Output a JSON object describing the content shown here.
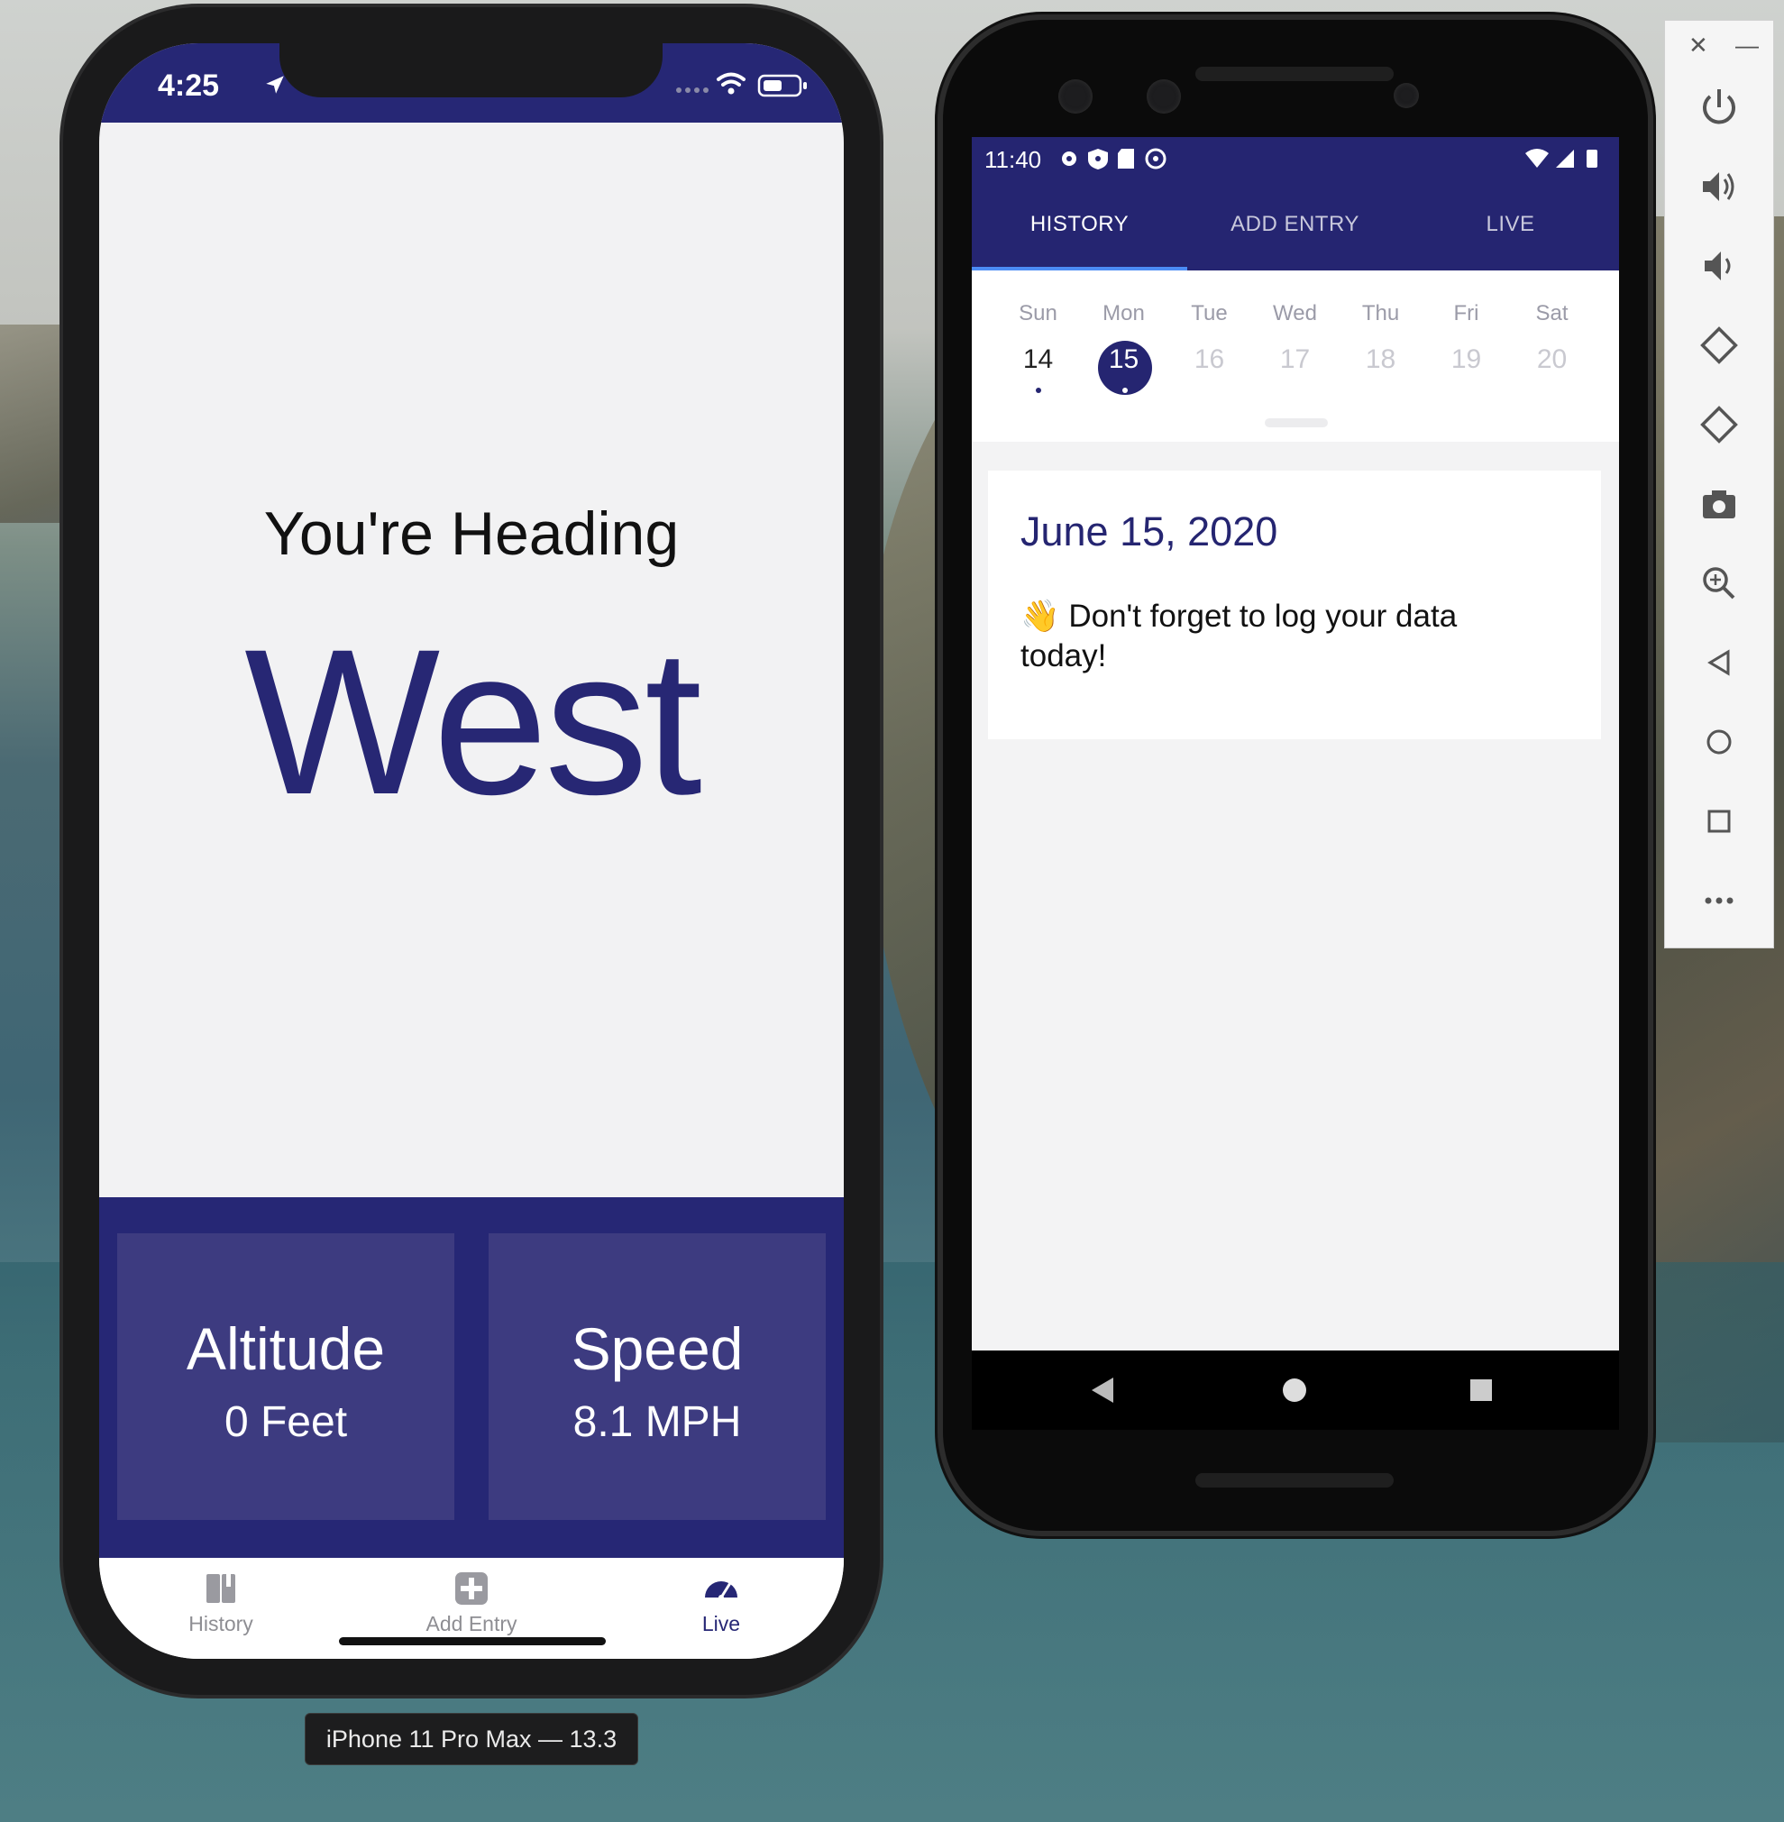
{
  "ios": {
    "status": {
      "time": "4:25"
    },
    "heading_label": "You're Heading",
    "heading_value": "West",
    "stats": [
      {
        "label": "Altitude",
        "value": "0 Feet"
      },
      {
        "label": "Speed",
        "value": "8.1 MPH"
      }
    ],
    "tabs": [
      {
        "label": "History",
        "icon": "book-icon"
      },
      {
        "label": "Add Entry",
        "icon": "plus-square-icon"
      },
      {
        "label": "Live",
        "icon": "speedometer-icon",
        "active": true
      }
    ],
    "device_label": "iPhone 11 Pro Max — 13.3"
  },
  "android": {
    "status": {
      "time": "11:40"
    },
    "tabs": [
      {
        "label": "HISTORY",
        "active": true
      },
      {
        "label": "ADD ENTRY"
      },
      {
        "label": "LIVE"
      }
    ],
    "calendar": {
      "day_names": [
        "Sun",
        "Mon",
        "Tue",
        "Wed",
        "Thu",
        "Fri",
        "Sat"
      ],
      "day_numbers": [
        "14",
        "15",
        "16",
        "17",
        "18",
        "19",
        "20"
      ],
      "selected": "15"
    },
    "entry": {
      "date": "June 15, 2020",
      "emoji": "👋",
      "note": "Don't forget to log your data today!"
    }
  },
  "colors": {
    "primary": "#262775",
    "card": "#3d3b80",
    "tab_indicator": "#4c8cf5"
  },
  "emulator_toolbar": {
    "icons": [
      "power-icon",
      "volume-up-icon",
      "volume-down-icon",
      "rotate-left-icon",
      "rotate-right-icon",
      "camera-icon",
      "zoom-in-icon",
      "back-icon",
      "home-icon",
      "overview-icon",
      "more-icon"
    ]
  }
}
